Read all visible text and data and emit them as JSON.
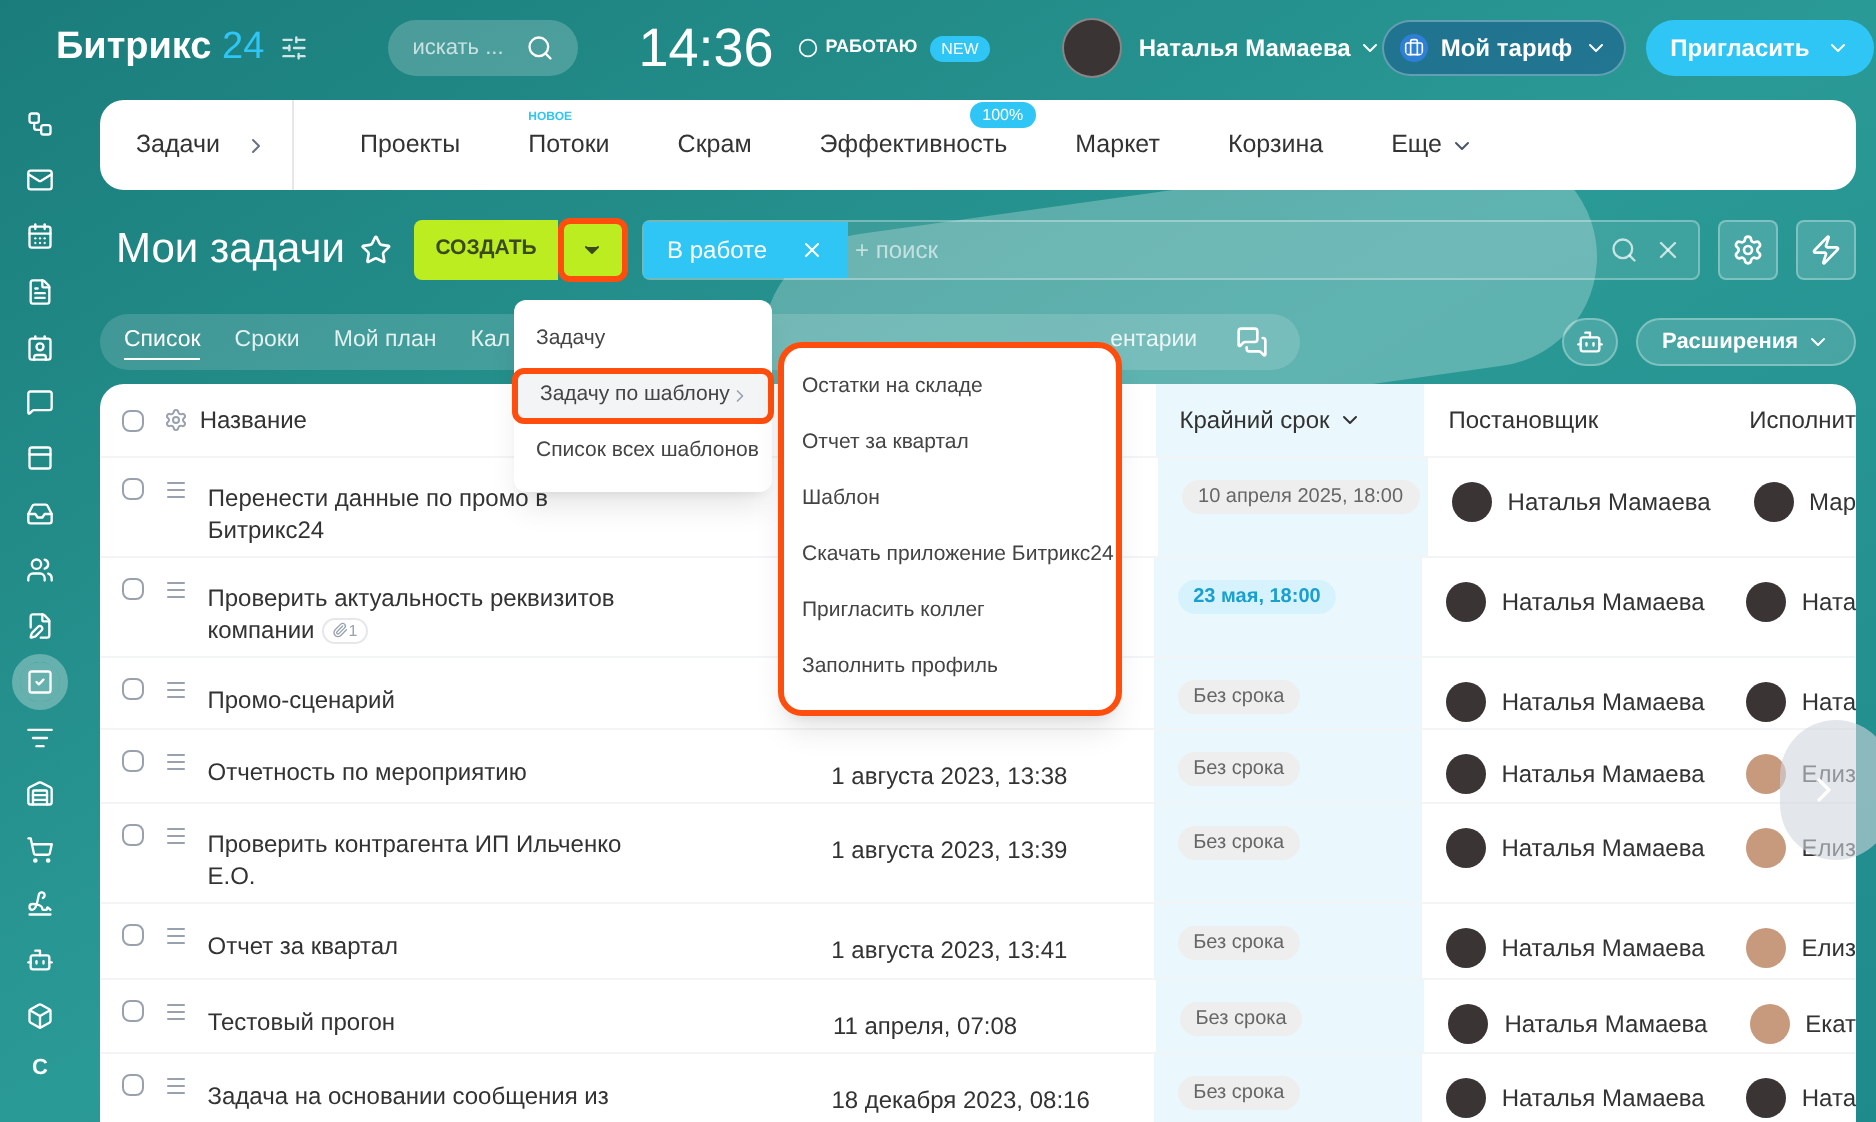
{
  "header": {
    "logo_text": "Битрикс",
    "logo_number": "24",
    "search": {
      "placeholder": "искать ..."
    },
    "time": "14:36",
    "work_status": "РАБОТАЮ",
    "new_badge": "NEW",
    "user_name": "Наталья Мамаева",
    "tariff_button": "Мой тариф",
    "invite_button": "Пригласить"
  },
  "sidebar": {
    "items": [
      {
        "selected": false
      },
      {
        "selected": false
      },
      {
        "selected": false
      },
      {
        "selected": false
      },
      {
        "selected": false
      },
      {
        "selected": false
      },
      {
        "selected": false
      },
      {
        "selected": false
      },
      {
        "selected": false
      },
      {
        "selected": false
      },
      {
        "selected": true
      },
      {
        "selected": false
      },
      {
        "selected": false
      },
      {
        "selected": false
      },
      {
        "selected": false
      },
      {
        "selected": false
      },
      {
        "selected": false
      }
    ],
    "letter": "С"
  },
  "nav": {
    "items": [
      {
        "label": "Задачи",
        "kind": "section"
      },
      {
        "label": "Проекты",
        "kind": "plain"
      },
      {
        "label": "Потоки",
        "kind": "new",
        "tag": "НОВОЕ"
      },
      {
        "label": "Скрам",
        "kind": "plain"
      },
      {
        "label": "Эффективность",
        "kind": "badge",
        "tag": "100%"
      },
      {
        "label": "Маркет",
        "kind": "plain"
      },
      {
        "label": "Корзина",
        "kind": "plain"
      },
      {
        "label": "Еще",
        "kind": "more"
      }
    ]
  },
  "toolbar": {
    "title": "Мои задачи",
    "create_button": "СОЗДАТЬ",
    "filter_chip": "В работе",
    "search_placeholder": "+ поиск"
  },
  "views": {
    "items": [
      {
        "label": "Список",
        "selected": true
      },
      {
        "label": "Сроки",
        "selected": false
      },
      {
        "label": "Мой план",
        "selected": false
      },
      {
        "label": "Кал",
        "selected": false
      },
      {
        "label": "ентарии",
        "selected": false
      }
    ],
    "extensions_button": "Расширения"
  },
  "create_menu": {
    "items": [
      {
        "label": "Задачу",
        "selected": false,
        "submenu": false
      },
      {
        "label": "Задачу по шаблону",
        "selected": true,
        "submenu": true
      },
      {
        "label": "Список всех шаблонов",
        "selected": false,
        "submenu": false
      }
    ]
  },
  "template_menu": {
    "items": [
      "Остатки на складе",
      "Отчет за квартал",
      "Шаблон",
      "Скачать приложение Битрикс24",
      "Пригласить коллег",
      "Заполнить профиль"
    ]
  },
  "table": {
    "select_all_checked": false,
    "columns": [
      "Название",
      "Крайний срок",
      "Постановщик",
      "Исполнит"
    ],
    "rows": [
      {
        "checked": false,
        "title": "Перенести данные по промо в Битрикс24",
        "deadline": {
          "text": "10 апреля 2025, 18:00",
          "kind": "plain"
        },
        "creator": "Наталья Мамаева",
        "assignee": "Мар"
      },
      {
        "checked": false,
        "title": "Проверить актуальность реквизитов компании",
        "attachments": "1",
        "deadline": {
          "text": "23 мая, 18:00",
          "kind": "highlight"
        },
        "creator": "Наталья Мамаева",
        "assignee": "Ната"
      },
      {
        "checked": false,
        "title": "Промо-сценарий",
        "deadline": {
          "text": "Без срока",
          "kind": "plain"
        },
        "creator": "Наталья Мамаева",
        "assignee": "Ната"
      },
      {
        "checked": false,
        "title": "Отчетность по мероприятию",
        "activity": "1 августа 2023, 13:38",
        "deadline": {
          "text": "Без срока",
          "kind": "plain"
        },
        "creator": "Наталья Мамаева",
        "assignee": "Елиз"
      },
      {
        "checked": false,
        "title": "Проверить контрагента ИП Ильченко Е.О.",
        "activity": "1 августа 2023, 13:39",
        "deadline": {
          "text": "Без срока",
          "kind": "plain"
        },
        "creator": "Наталья Мамаева",
        "assignee": "Елиз"
      },
      {
        "checked": false,
        "title": "Отчет за квартал",
        "activity": "1 августа 2023, 13:41",
        "deadline": {
          "text": "Без срока",
          "kind": "plain"
        },
        "creator": "Наталья Мамаева",
        "assignee": "Елиз"
      },
      {
        "checked": false,
        "title": "Тестовый прогон",
        "activity": "11 апреля, 07:08",
        "deadline": {
          "text": "Без срока",
          "kind": "plain"
        },
        "creator": "Наталья Мамаева",
        "assignee": "Екат"
      },
      {
        "checked": false,
        "title": "Задача на основании сообщения из",
        "activity": "18 декабря 2023, 08:16",
        "deadline": {
          "text": "Без срока",
          "kind": "plain"
        },
        "creator": "Наталья Мамаева",
        "assignee": "Ната"
      }
    ]
  }
}
